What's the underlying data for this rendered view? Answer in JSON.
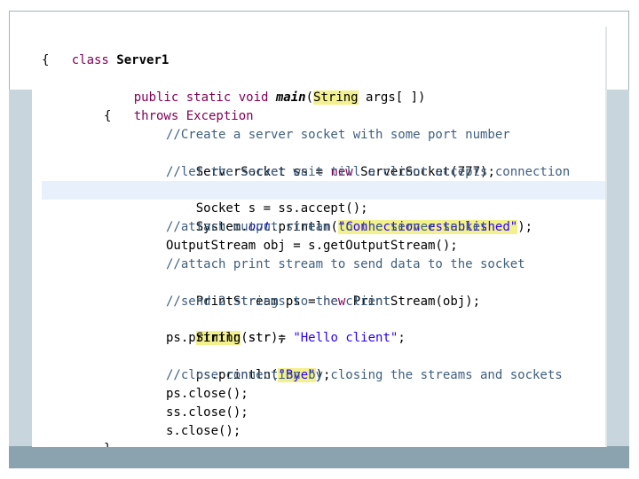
{
  "code": {
    "line1": [
      "class ",
      "Server1"
    ],
    "line2": "{",
    "line3": [
      "public static void ",
      "main",
      "(",
      "String",
      " args[ ])"
    ],
    "line4": "throws Exception",
    "line5": "{",
    "line6": "//Create a server socket with some port number",
    "line7": [
      "ServerSocket ss = ",
      "new",
      " ServerSocket(777);"
    ],
    "line8": "//let the server wait till a client accepts connection",
    "line9": "Socket s = ss.accept();",
    "line10": [
      "System.",
      "out",
      ".println(",
      "\"Connection established\"",
      ");"
    ],
    "line11": "//attach output stream to the server socket",
    "line12": "OutputStream obj = s.getOutputStream();",
    "line13": "//attach print stream to send data to the socket",
    "line14": [
      "PrintStream ps = ",
      "new",
      " PrintStream(obj);"
    ],
    "line15": "//send 2 strings to the client",
    "line16": [
      "String",
      " str = ",
      "\"Hello client\"",
      ";"
    ],
    "line17": "ps.println(str);",
    "line18": [
      "ps.println(",
      "\"Bye\"",
      ");"
    ],
    "line19": "//close connection by closing the streams and sockets",
    "line20": "ps.close();",
    "line21": "ss.close();",
    "line22": "s.close();",
    "line23": "}"
  },
  "colors": {
    "keyword": "#7f0055",
    "comment": "#3f5f7f",
    "string": "#2a00ff",
    "highlight_line": "#e8f0fb",
    "token_highlight": "#f3f08e"
  }
}
